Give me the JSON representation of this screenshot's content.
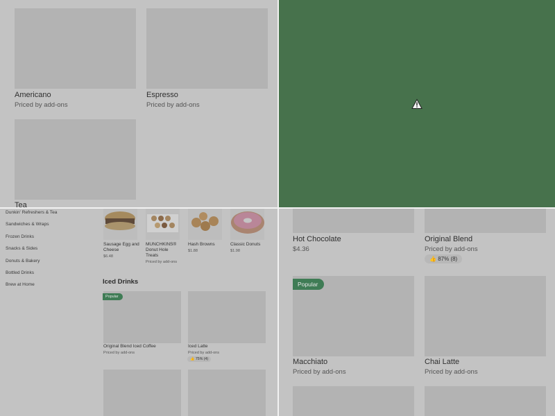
{
  "top_left": {
    "items": [
      {
        "name": "Americano",
        "price": "Priced by add-ons"
      },
      {
        "name": "Espresso",
        "price": "Priced by add-ons"
      },
      {
        "name": "Tea"
      }
    ]
  },
  "top_right": {
    "icon": "warning-icon",
    "background": "#47724c"
  },
  "bottom_left": {
    "categories": [
      "Dunkin' Refreshers & Tea",
      "Sandwiches & Wraps",
      "Frozen Drinks",
      "Snacks & Sides",
      "Donuts & Bakery",
      "Bottled Drinks",
      "Brew at Home"
    ],
    "row_items": [
      {
        "name": "Sausage Egg and Cheese",
        "price": "$6.48"
      },
      {
        "name": "MUNCHKINS® Donut Hole Treats",
        "price": "Priced by add-ons"
      },
      {
        "name": "Hash Browns",
        "price": "$1.88"
      },
      {
        "name": "Classic Donuts",
        "price": "$1.98"
      }
    ],
    "section_title": "Iced Drinks",
    "badge": "Popular",
    "iced_items": [
      {
        "name": "Original Blend Iced Coffee",
        "price": "Priced by add-ons"
      },
      {
        "name": "Iced Latte",
        "price": "Priced by add-ons",
        "rating": "75% (4)"
      }
    ]
  },
  "bottom_right": {
    "items": [
      {
        "name": "Hot Chocolate",
        "price": "$4.36"
      },
      {
        "name": "Original Blend",
        "price": "Priced by add-ons",
        "rating": "87% (8)"
      },
      {
        "name": "Macchiato",
        "price": "Priced by add-ons"
      },
      {
        "name": "Chai Latte",
        "price": "Priced by add-ons"
      }
    ],
    "badge": "Popular"
  }
}
